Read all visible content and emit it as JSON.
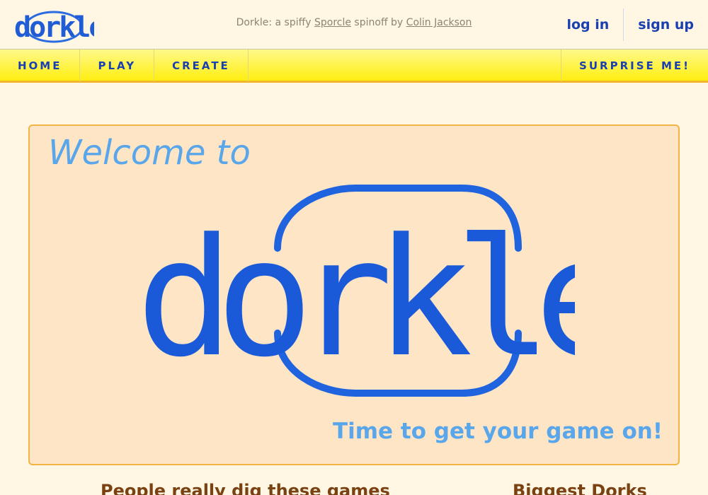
{
  "brand": {
    "name": "dorkle!",
    "tagline_prefix": "Dorkle: a spiffy ",
    "tagline_link1": "Sporcle",
    "tagline_middle": " spinoff by ",
    "tagline_link2": "Colin Jackson",
    "accent_color": "#1a3fb0",
    "light_accent": "#5aa6ea"
  },
  "auth": {
    "login": "log in",
    "signup": "sign up"
  },
  "nav": {
    "home": "HOME",
    "play": "PLAY",
    "create": "CREATE",
    "surprise": "SURPRISE ME!"
  },
  "hero": {
    "welcome": "Welcome to",
    "logo_text": "dorkle!",
    "cta": "Time to get your game on!"
  },
  "sections": {
    "popular": "People really dig these games",
    "dorks": "Biggest Dorks"
  }
}
